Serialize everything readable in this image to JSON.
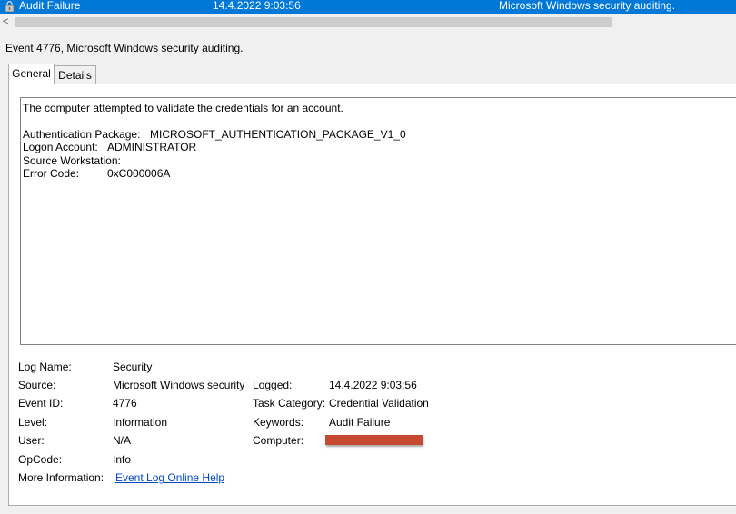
{
  "event_row": {
    "level": "Audit Failure",
    "date": "14.4.2022 9:03:56",
    "source": "Microsoft Windows security auditing.",
    "level_icon": "lock-icon"
  },
  "scrollbar": {
    "left_arrow": "<"
  },
  "header": {
    "title": "Event 4776, Microsoft Windows security auditing."
  },
  "tabs": [
    {
      "label": "General",
      "selected": true
    },
    {
      "label": "Details",
      "selected": false
    }
  ],
  "description": {
    "line1": "The computer attempted to validate the credentials for an account.",
    "fields": [
      {
        "label": "Authentication Package:",
        "value": "MICROSOFT_AUTHENTICATION_PACKAGE_V1_0"
      },
      {
        "label": "Logon Account:",
        "value": "ADMINISTRATOR"
      },
      {
        "label": "Source Workstation:",
        "value": ""
      },
      {
        "label": "Error Code:",
        "value": "0xC000006A"
      }
    ]
  },
  "details": {
    "log_name_label": "Log Name:",
    "log_name": "Security",
    "source_label": "Source:",
    "source": "Microsoft Windows security",
    "logged_label": "Logged:",
    "logged": "14.4.2022 9:03:56",
    "event_id_label": "Event ID:",
    "event_id": "4776",
    "task_category_label": "Task Category:",
    "task_category": "Credential Validation",
    "level_label": "Level:",
    "level": "Information",
    "keywords_label": "Keywords:",
    "keywords": "Audit Failure",
    "user_label": "User:",
    "user": "N/A",
    "computer_label": "Computer:",
    "opcode_label": "OpCode:",
    "opcode": "Info",
    "more_info_label": "More Information:",
    "more_info_link": "Event Log Online Help"
  },
  "colors": {
    "selection": "#0078d7",
    "link": "#0047c8",
    "redaction": "#c64a32"
  }
}
